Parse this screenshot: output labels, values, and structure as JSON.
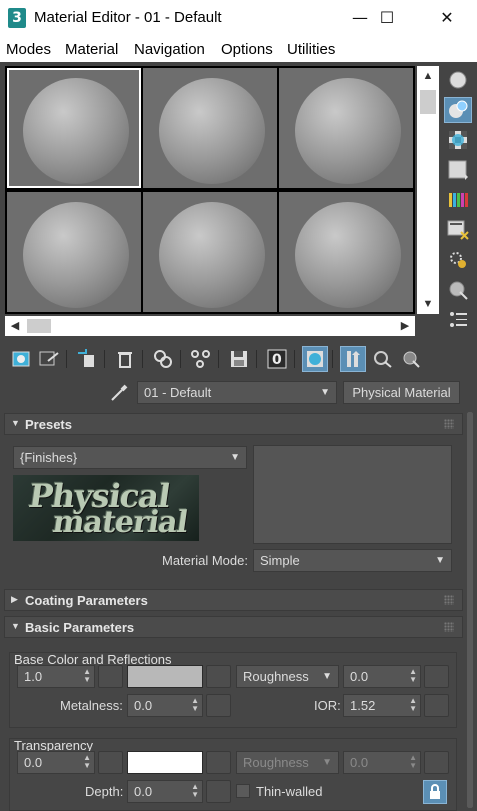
{
  "window": {
    "title": "Material Editor - 01 - Default",
    "app_icon": "3",
    "min": "—",
    "max": "☐",
    "close": "✕"
  },
  "menu": [
    "Modes",
    "Material",
    "Navigation",
    "Options",
    "Utilities"
  ],
  "material_name": "01 - Default",
  "material_type": "Physical Material",
  "presets": {
    "title": "Presets",
    "dropdown": "{Finishes}",
    "logo_line1": "Physical",
    "logo_line2": "material",
    "material_mode_label": "Material Mode:",
    "material_mode_value": "Simple"
  },
  "coating": {
    "title": "Coating Parameters"
  },
  "basic": {
    "title": "Basic Parameters",
    "base_group": "Base Color and Reflections",
    "base_weight": "1.0",
    "base_color": "#b8b8b8",
    "roughness_mode": "Roughness",
    "roughness_value": "0.0",
    "metalness_label": "Metalness:",
    "metalness_value": "0.0",
    "ior_label": "IOR:",
    "ior_value": "1.52",
    "transparency_group": "Transparency",
    "trans_weight": "0.0",
    "trans_color": "#ffffff",
    "trans_roughness_mode": "Roughness",
    "trans_roughness_value": "0.0",
    "depth_label": "Depth:",
    "depth_value": "0.0",
    "thin_walled_label": "Thin-walled"
  },
  "icons": {
    "sample_type": "sphere-sample-icon",
    "backlight": "backlight-icon",
    "background": "checker-background-icon",
    "uv_tiling": "uv-tiling-icon",
    "video_check": "video-color-check-icon",
    "make_preview": "make-preview-icon",
    "options": "options-icon",
    "select_by_material": "select-by-material-icon",
    "navigator": "material-navigator-icon"
  },
  "accent_color": "#5b8fb5"
}
